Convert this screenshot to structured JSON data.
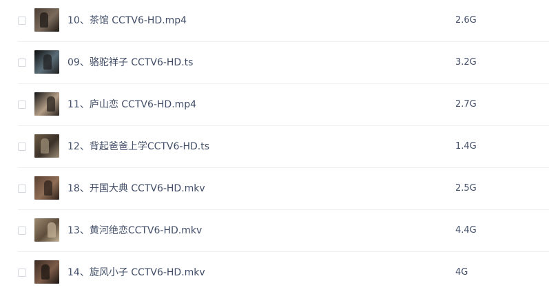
{
  "files": [
    {
      "name": "10、茶馆 CCTV6-HD.mp4",
      "size": "2.6G",
      "thumbnail": "video-frame",
      "thumb_colors": [
        "#4a3d33",
        "#7a6a5c",
        "#1f1a16"
      ]
    },
    {
      "name": "09、骆驼祥子 CCTV6-HD.ts",
      "size": "3.2G",
      "thumbnail": "video-frame",
      "thumb_colors": [
        "#0c0c0c",
        "#5b6e78",
        "#202020"
      ]
    },
    {
      "name": "11、庐山恋 CCTV6-HD.mp4",
      "size": "2.7G",
      "thumbnail": "video-frame",
      "thumb_colors": [
        "#141414",
        "#b39d86",
        "#2b241f"
      ]
    },
    {
      "name": "12、背起爸爸上学CCTV6-HD.ts",
      "size": "1.4G",
      "thumbnail": "video-frame",
      "thumb_colors": [
        "#6d5a44",
        "#3a3128",
        "#9b8c76"
      ]
    },
    {
      "name": "18、开国大典 CCTV6-HD.mkv",
      "size": "2.5G",
      "thumbnail": "video-frame",
      "thumb_colors": [
        "#5a4132",
        "#8f6d55",
        "#2d211b"
      ]
    },
    {
      "name": "13、黄河绝恋CCTV6-HD.mkv",
      "size": "4.4G",
      "thumbnail": "video-frame",
      "thumb_colors": [
        "#9c8a70",
        "#5e4d3b",
        "#c2b096"
      ]
    },
    {
      "name": "14、旋风小子 CCTV6-HD.mkv",
      "size": "4G",
      "thumbnail": "video-frame",
      "thumb_colors": [
        "#3b2a22",
        "#7c5b48",
        "#1b1512"
      ]
    }
  ]
}
